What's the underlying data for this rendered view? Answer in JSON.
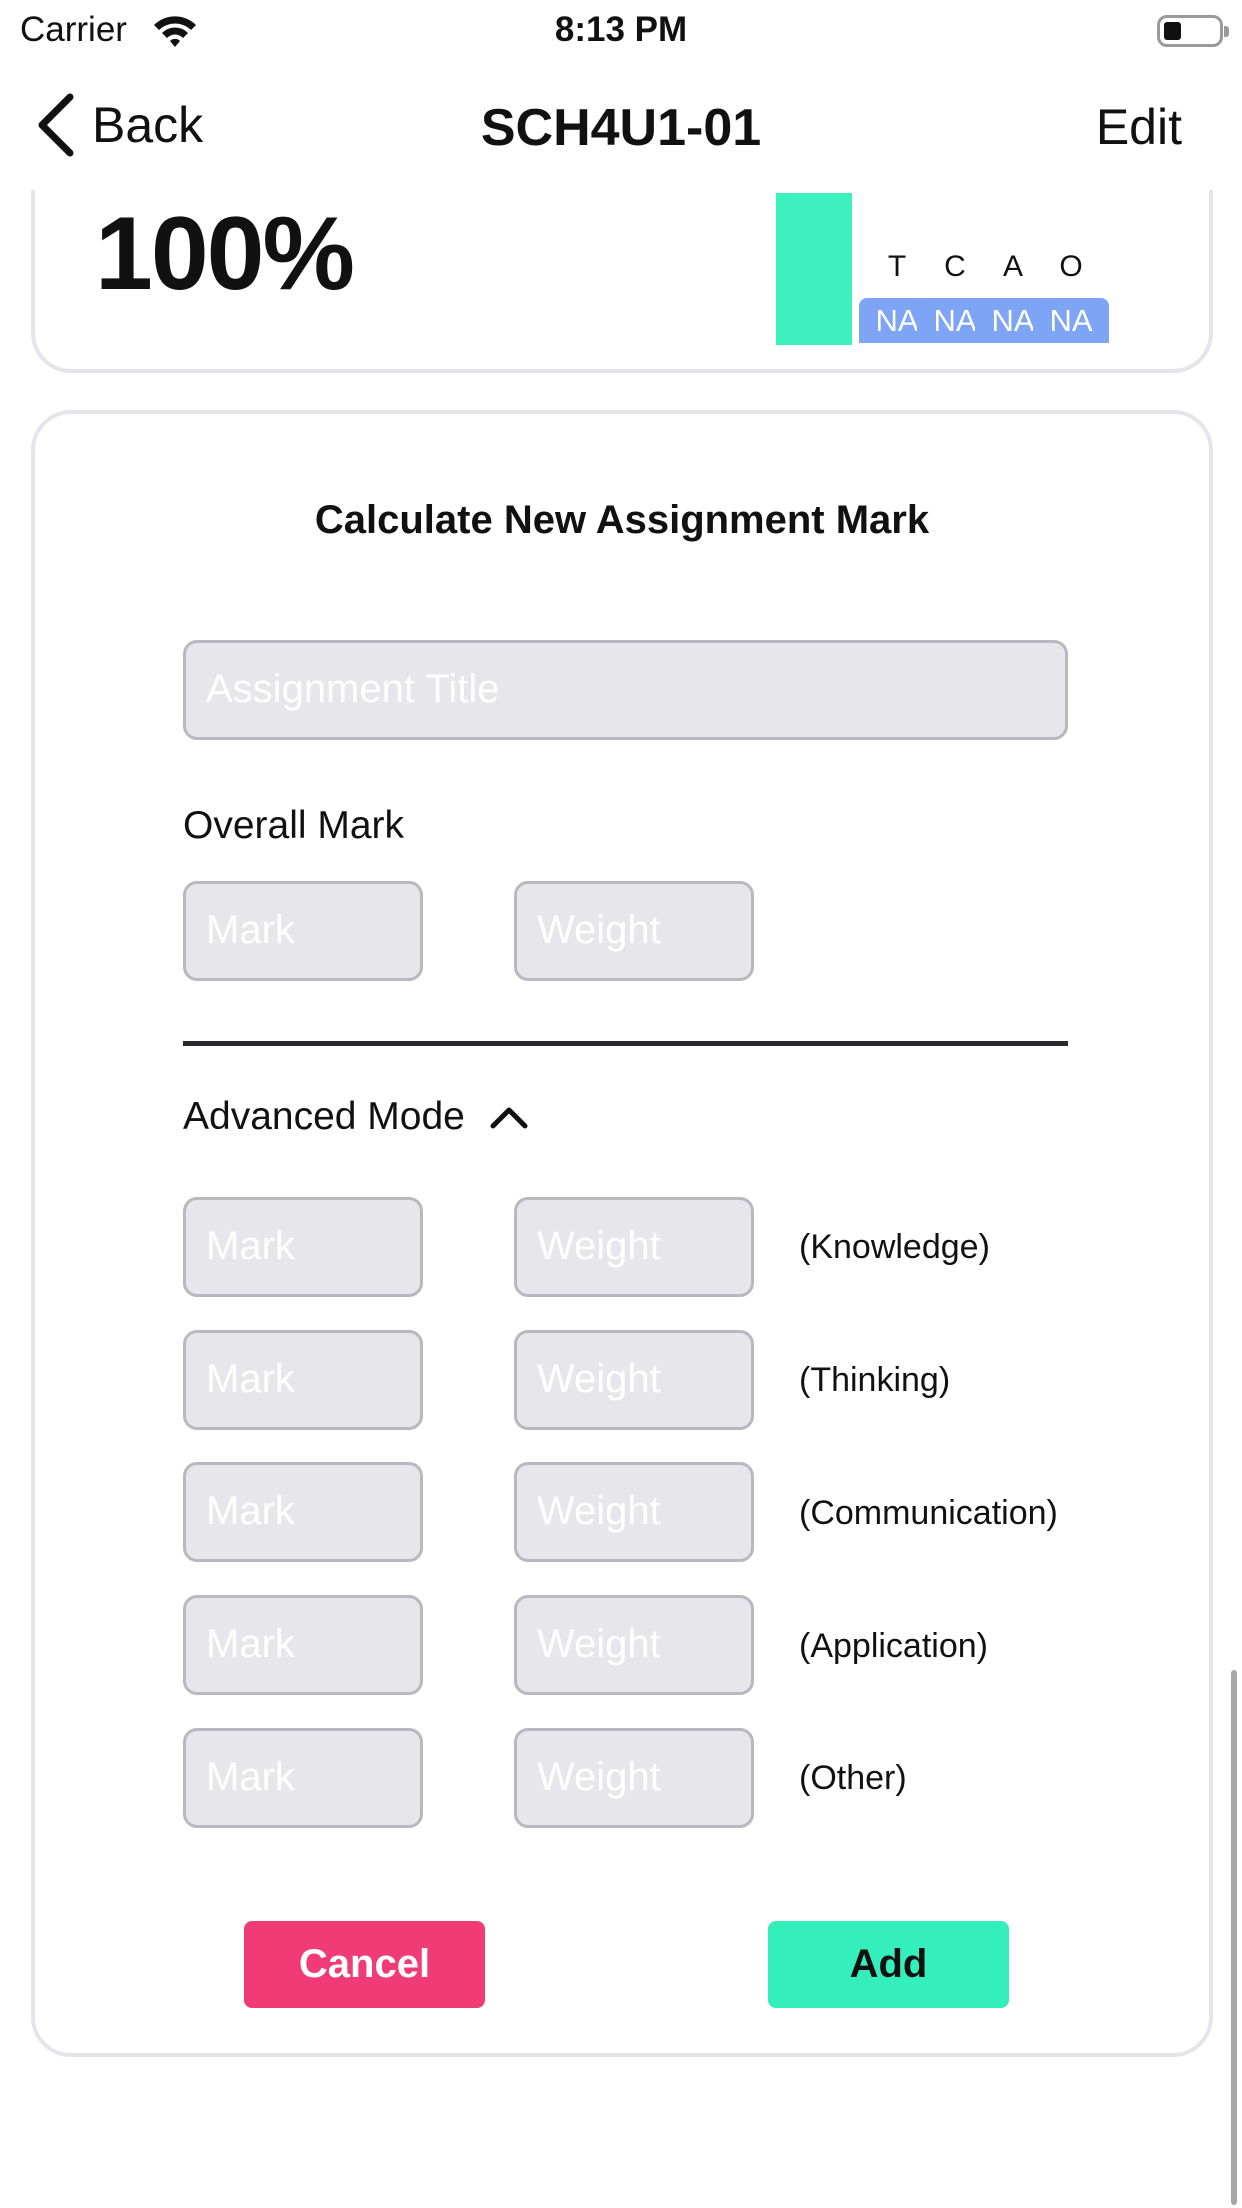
{
  "status_bar": {
    "carrier": "Carrier",
    "time": "8:13 PM"
  },
  "nav": {
    "back_label": "Back",
    "title": "SCH4U1-01",
    "edit_label": "Edit"
  },
  "summary": {
    "overall_percent": "100%",
    "categories": [
      {
        "letter": "T",
        "value": "NA"
      },
      {
        "letter": "C",
        "value": "NA"
      },
      {
        "letter": "A",
        "value": "NA"
      },
      {
        "letter": "O",
        "value": "NA"
      }
    ],
    "colors": {
      "bar": "#3df0bd",
      "na_badge": "#7da4f5"
    }
  },
  "form": {
    "title": "Calculate New Assignment Mark",
    "assignment_title_placeholder": "Assignment Title",
    "overall_label": "Overall Mark",
    "mark_placeholder": "Mark",
    "weight_placeholder": "Weight",
    "advanced_label": "Advanced Mode",
    "advanced_rows": [
      {
        "category": "(Knowledge)"
      },
      {
        "category": "(Thinking)"
      },
      {
        "category": "(Communication)"
      },
      {
        "category": "(Application)"
      },
      {
        "category": "(Other)"
      }
    ],
    "cancel_label": "Cancel",
    "add_label": "Add",
    "colors": {
      "cancel": "#f03b76",
      "add": "#34efbb"
    }
  }
}
